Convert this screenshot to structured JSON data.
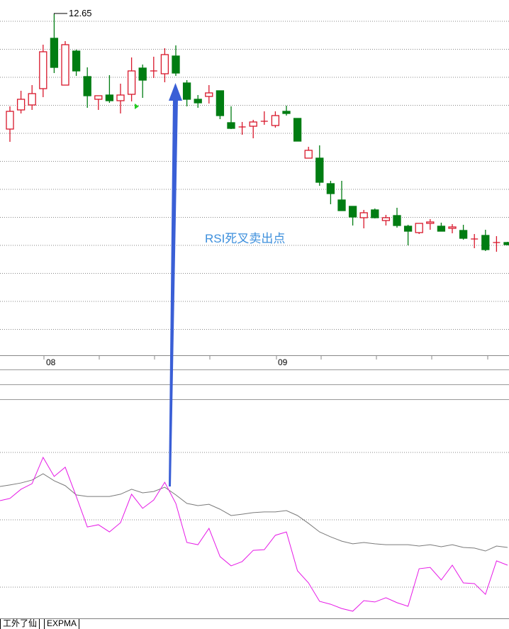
{
  "chart_data": {
    "type": "candlestick",
    "price_label": "12.65",
    "x_ticks": [
      "08",
      "09"
    ],
    "annotation": "RSI死叉卖出点",
    "colors": {
      "up": "#d8172b",
      "down": "#007d12",
      "rsi_fast": "#e619e6",
      "rsi_slow": "#7a7a7a",
      "arrow": "#3a5fd6",
      "annotation": "#3d8fdc"
    },
    "candles": [
      [
        11.03,
        11.28,
        11.35,
        10.85
      ],
      [
        11.3,
        11.45,
        11.57,
        11.25
      ],
      [
        11.37,
        11.53,
        11.65,
        11.3
      ],
      [
        11.6,
        12.12,
        12.22,
        11.48
      ],
      [
        12.31,
        11.9,
        12.65,
        11.82
      ],
      [
        11.65,
        12.22,
        12.27,
        11.65
      ],
      [
        12.13,
        11.85,
        12.15,
        11.78
      ],
      [
        11.77,
        11.5,
        11.9,
        11.33
      ],
      [
        11.45,
        11.5,
        11.5,
        11.3
      ],
      [
        11.51,
        11.43,
        11.79,
        11.4
      ],
      [
        11.43,
        11.51,
        11.67,
        11.25
      ],
      [
        11.52,
        11.85,
        12.04,
        11.42
      ],
      [
        11.89,
        11.72,
        11.94,
        11.47
      ],
      [
        11.85,
        11.85,
        12.05,
        11.75
      ],
      [
        11.81,
        12.08,
        12.17,
        11.69
      ],
      [
        12.06,
        11.82,
        12.21,
        11.78
      ],
      [
        11.68,
        11.45,
        11.72,
        11.35
      ],
      [
        11.45,
        11.4,
        11.51,
        11.33
      ],
      [
        11.49,
        11.54,
        11.65,
        11.39
      ],
      [
        11.57,
        11.22,
        11.57,
        11.17
      ],
      [
        11.12,
        11.04,
        11.35,
        11.03
      ],
      [
        11.06,
        11.06,
        11.13,
        10.95
      ],
      [
        11.07,
        11.13,
        11.16,
        10.9
      ],
      [
        11.14,
        11.14,
        11.28,
        11.09
      ],
      [
        11.08,
        11.22,
        11.28,
        11.05
      ],
      [
        11.28,
        11.25,
        11.36,
        11.22
      ],
      [
        11.18,
        10.86,
        11.18,
        10.86
      ],
      [
        10.62,
        10.73,
        10.78,
        10.62
      ],
      [
        10.62,
        10.28,
        10.8,
        10.23
      ],
      [
        10.26,
        10.12,
        10.3,
        9.97
      ],
      [
        10.03,
        9.88,
        10.3,
        9.88
      ],
      [
        9.94,
        9.79,
        9.94,
        9.67
      ],
      [
        9.78,
        9.85,
        9.89,
        9.63
      ],
      [
        9.89,
        9.78,
        9.91,
        9.77
      ],
      [
        9.74,
        9.78,
        9.82,
        9.67
      ],
      [
        9.81,
        9.67,
        9.92,
        9.64
      ],
      [
        9.66,
        9.59,
        9.68,
        9.39
      ],
      [
        9.57,
        9.7,
        9.7,
        9.55
      ],
      [
        9.7,
        9.72,
        9.76,
        9.61
      ],
      [
        9.66,
        9.59,
        9.71,
        9.59
      ],
      [
        9.63,
        9.65,
        9.69,
        9.56
      ],
      [
        9.6,
        9.49,
        9.68,
        9.47
      ],
      [
        9.48,
        9.48,
        9.55,
        9.35
      ],
      [
        9.53,
        9.33,
        9.61,
        9.31
      ],
      [
        9.43,
        9.43,
        9.52,
        9.3
      ],
      [
        9.43,
        9.4,
        9.44,
        9.39
      ]
    ],
    "rsi_fast": [
      59.5,
      63.6,
      66.1,
      77.8,
      69.3,
      73.4,
      60.4,
      46.8,
      47.8,
      44.6,
      48.7,
      61.4,
      55.1,
      58.8,
      66.7,
      57.3,
      39.9,
      38.9,
      46.2,
      33.6,
      29.5,
      31.4,
      36.4,
      36.7,
      43.1,
      44.6,
      27.3,
      21.9,
      13.7,
      12.4,
      10.5,
      9.3,
      14.0,
      13.4,
      15.3,
      13.1,
      11.5,
      28.2,
      28.8,
      23.2,
      29.8,
      21.9,
      21.6,
      16.8,
      31.7,
      29.8
    ],
    "rsi_slow": [
      65.5,
      66.4,
      67.7,
      70.5,
      67.4,
      65.2,
      61.1,
      60.4,
      60.4,
      60.4,
      61.4,
      63.6,
      62.0,
      62.6,
      64.5,
      61.1,
      57.3,
      56.3,
      56.9,
      54.7,
      51.9,
      52.5,
      53.2,
      53.5,
      53.5,
      54.1,
      51.9,
      48.4,
      44.6,
      42.4,
      40.5,
      39.3,
      39.9,
      39.3,
      38.9,
      38.9,
      38.9,
      38.3,
      38.9,
      38.0,
      38.9,
      37.7,
      37.4,
      36.1,
      38.3,
      37.7
    ],
    "signal_candle_index": 15
  },
  "tabs": [
    "工外了仙",
    "EXPMA"
  ]
}
